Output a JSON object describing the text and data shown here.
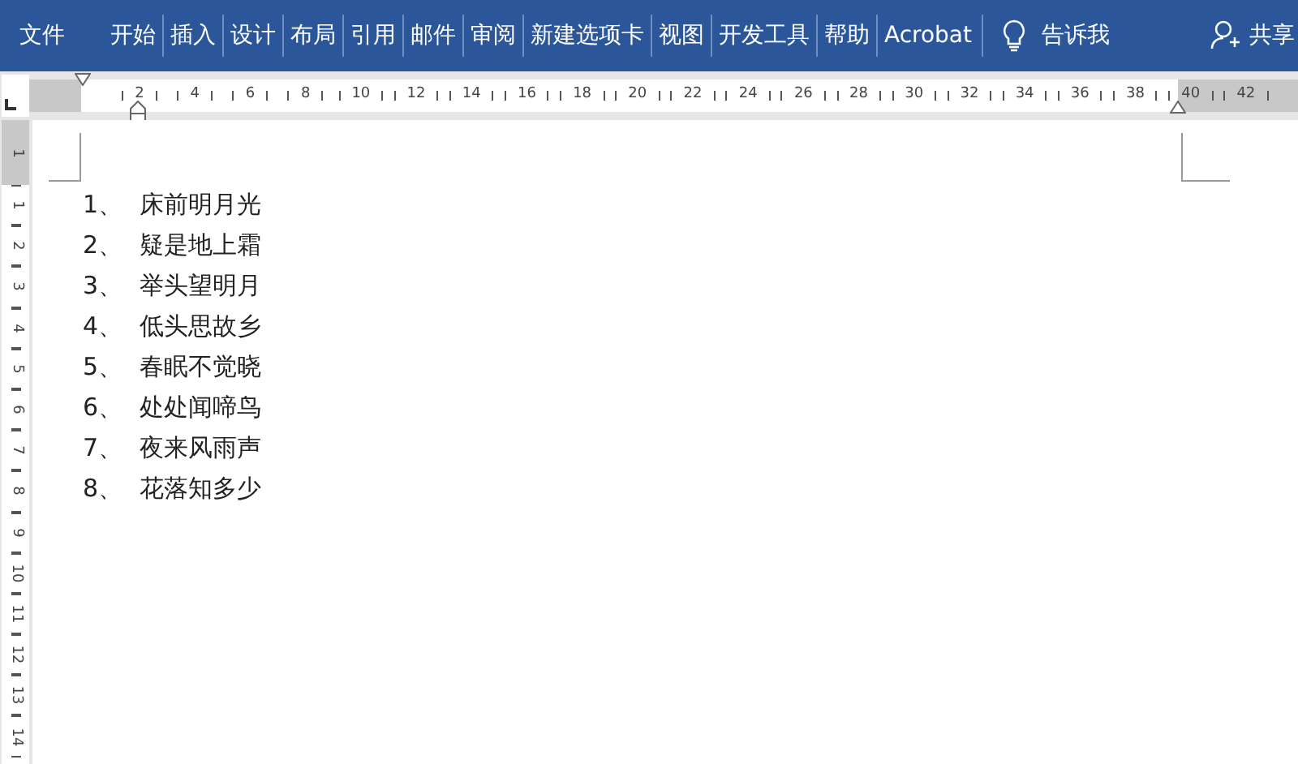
{
  "ribbon": {
    "tabs": [
      {
        "label": "文件"
      },
      {
        "label": "开始"
      },
      {
        "label": "插入"
      },
      {
        "label": "设计"
      },
      {
        "label": "布局"
      },
      {
        "label": "引用"
      },
      {
        "label": "邮件"
      },
      {
        "label": "审阅"
      },
      {
        "label": "新建选项卡"
      },
      {
        "label": "视图"
      },
      {
        "label": "开发工具"
      },
      {
        "label": "帮助"
      },
      {
        "label": "Acrobat"
      }
    ],
    "tell_me": "告诉我",
    "share": "共享"
  },
  "ruler": {
    "marks": [
      "2",
      "4",
      "6",
      "8",
      "10",
      "12",
      "14",
      "16",
      "18",
      "20",
      "22",
      "24",
      "26",
      "28",
      "30",
      "32",
      "34",
      "36",
      "38",
      "40",
      "42"
    ]
  },
  "vertical_ruler": {
    "marks": [
      "1",
      "1",
      "2",
      "3",
      "4",
      "5",
      "6",
      "7",
      "8",
      "9",
      "10",
      "11",
      "12",
      "13",
      "14"
    ]
  },
  "document": {
    "list": [
      {
        "number": "1、",
        "text": "床前明月光"
      },
      {
        "number": "2、",
        "text": "疑是地上霜"
      },
      {
        "number": "3、",
        "text": "举头望明月"
      },
      {
        "number": "4、",
        "text": "低头思故乡"
      },
      {
        "number": "5、",
        "text": "春眠不觉晓"
      },
      {
        "number": "6、",
        "text": "处处闻啼鸟"
      },
      {
        "number": "7、",
        "text": "夜来风雨声"
      },
      {
        "number": "8、",
        "text": "花落知多少"
      }
    ]
  }
}
